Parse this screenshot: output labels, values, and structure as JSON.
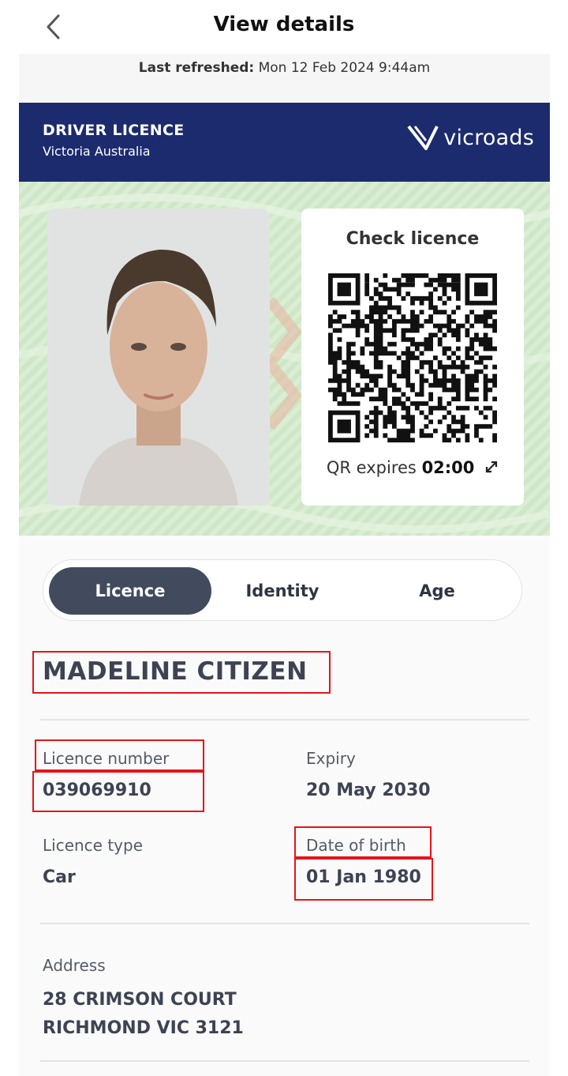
{
  "header": {
    "title": "View details"
  },
  "refresh": {
    "label": "Last refreshed:",
    "value": "Mon 12 Feb 2024 9:44am"
  },
  "card": {
    "title": "DRIVER LICENCE",
    "subtitle": "Victoria Australia",
    "brand": "vicroads",
    "brand_color": "#1c2b6e",
    "background_color": "#d4eacd"
  },
  "qr": {
    "title": "Check licence",
    "expires_label": "QR expires",
    "expires_value": "02:00"
  },
  "tabs": [
    {
      "label": "Licence",
      "active": true
    },
    {
      "label": "Identity",
      "active": false
    },
    {
      "label": "Age",
      "active": false
    }
  ],
  "holder": {
    "name": "MADELINE CITIZEN"
  },
  "fields": {
    "licence_number": {
      "label": "Licence number",
      "value": "039069910"
    },
    "expiry": {
      "label": "Expiry",
      "value": "20 May 2030"
    },
    "licence_type": {
      "label": "Licence type",
      "value": "Car"
    },
    "date_of_birth": {
      "label": "Date of birth",
      "value": "01 Jan 1980"
    }
  },
  "address": {
    "label": "Address",
    "line1": "28 CRIMSON COURT",
    "line2": "RICHMOND VIC 3121"
  },
  "highlight_color": "#e3161b",
  "icons": {
    "back": "chevron-left-icon",
    "expand": "expand-diagonal-icon",
    "logo": "vicroads-logo"
  }
}
